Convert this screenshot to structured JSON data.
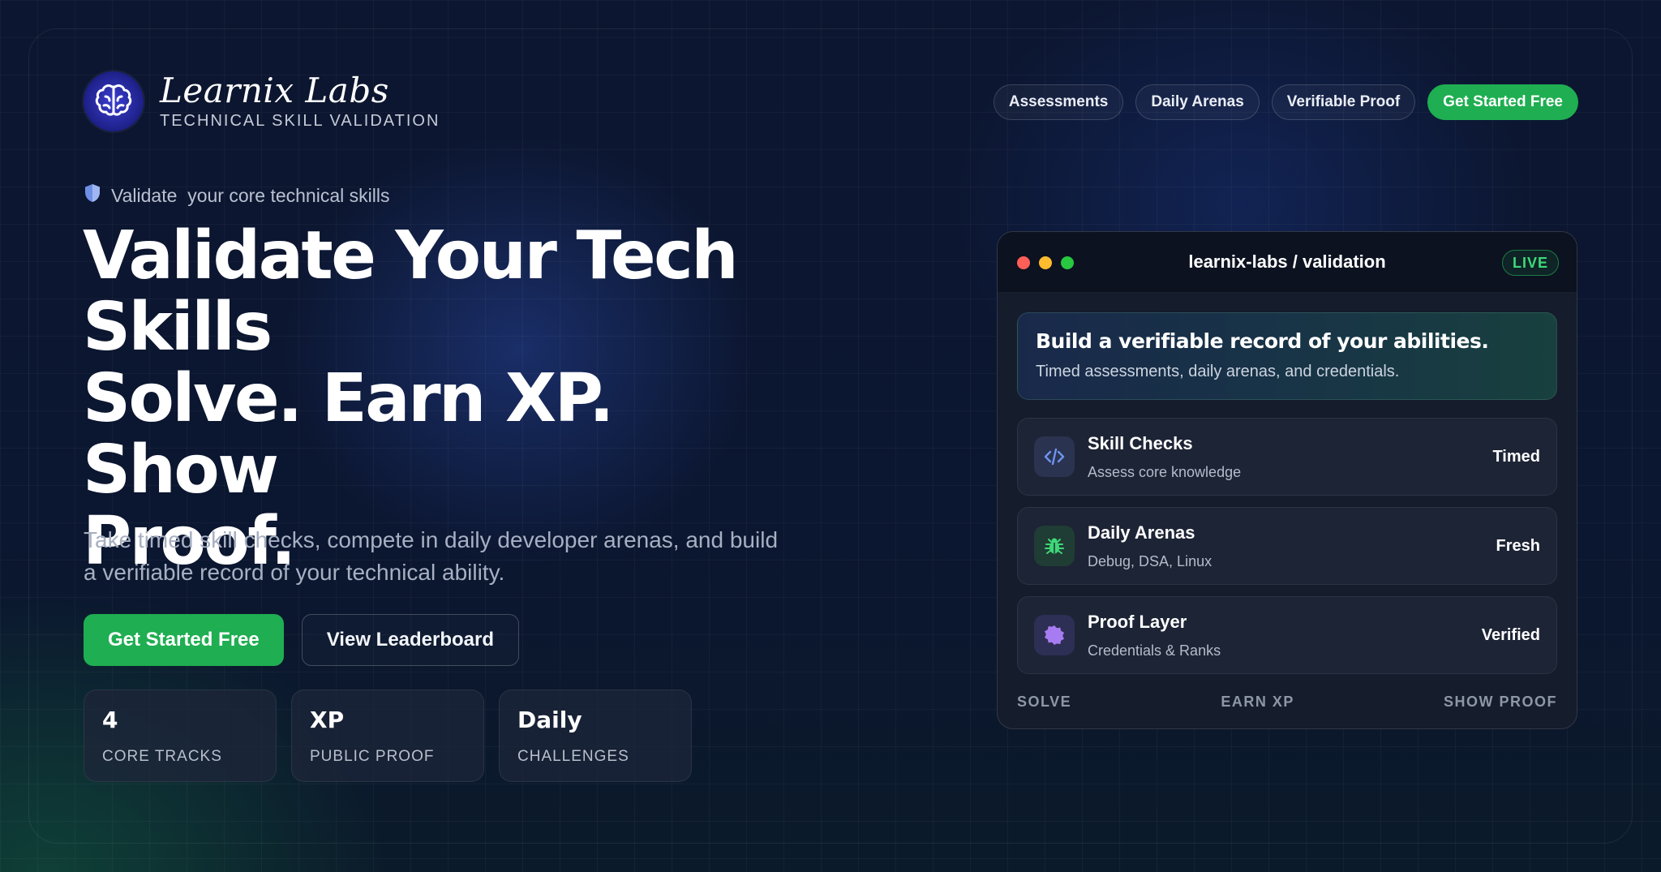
{
  "brand": {
    "name": "Learnix Labs",
    "tagline": "TECHNICAL SKILL VALIDATION",
    "logo_icon": "brain-icon"
  },
  "nav": {
    "items": [
      "Assessments",
      "Daily Arenas",
      "Verifiable Proof"
    ],
    "cta": "Get Started Free"
  },
  "hero": {
    "eyebrow": "Validate  your core technical skills",
    "title_line1": "Validate Your Tech",
    "title_line2": "Skills",
    "title_line3": "Solve. Earn XP. Show",
    "title_line4": "Proof.",
    "description": "Take timed skill checks, compete in daily developer arenas, and build a verifiable record of your technical ability.",
    "primary_cta": "Get Started Free",
    "secondary_cta": "View Leaderboard"
  },
  "stats": [
    {
      "value": "4",
      "label": "CORE TRACKS"
    },
    {
      "value": "XP",
      "label": "PUBLIC PROOF"
    },
    {
      "value": "Daily",
      "label": "CHALLENGES"
    }
  ],
  "window": {
    "title": "learnix-labs / validation",
    "badge": "LIVE",
    "banner_title": "Build a verifiable record of your abilities.",
    "banner_sub": "Timed assessments, daily arenas, and credentials.",
    "rows": [
      {
        "title": "Skill Checks",
        "subtitle": "Assess core knowledge",
        "tag": "Timed",
        "icon": "code-icon"
      },
      {
        "title": "Daily Arenas",
        "subtitle": "Debug, DSA, Linux",
        "tag": "Fresh",
        "icon": "bug-icon"
      },
      {
        "title": "Proof Layer",
        "subtitle": "Credentials & Ranks",
        "tag": "Verified",
        "icon": "badge-icon"
      }
    ],
    "footer": [
      "SOLVE",
      "EARN XP",
      "SHOW PROOF"
    ]
  },
  "colors": {
    "accent_green": "#1fae51",
    "background": "#0b1428",
    "live_green": "#3fd879"
  }
}
